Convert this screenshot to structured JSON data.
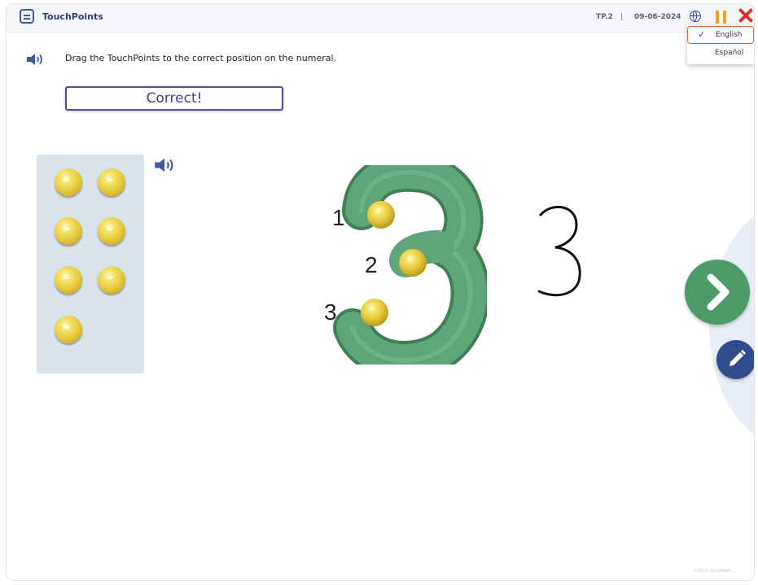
{
  "app": {
    "title": "TouchPoints",
    "code": "TP.2",
    "separator": "|",
    "date": "09-06-2024"
  },
  "language_menu": {
    "options": [
      "English",
      "Español"
    ],
    "selected": "English"
  },
  "instruction": "Drag the TouchPoints to the correct position on the numeral.",
  "feedback": "Correct!",
  "tray": {
    "remaining_touchpoints": 7
  },
  "numeral": {
    "value": "3",
    "touchpoint_labels": [
      "1",
      "2",
      "3"
    ]
  },
  "copyright": "©2023 TouchMath",
  "colors": {
    "numeral_green": "#5fa57a",
    "next_green": "#4e9b6a",
    "edit_blue": "#2f4c8f",
    "pause_orange": "#f0a21c",
    "close_red": "#d6322a",
    "feedback_purple": "#5b4896",
    "tray_bg": "#d9e3ec"
  },
  "icons": [
    "app-logo-icon",
    "globe-icon",
    "pause-icon",
    "close-icon",
    "check-icon",
    "speaker-icon",
    "chevron-right-icon",
    "pencil-icon"
  ]
}
